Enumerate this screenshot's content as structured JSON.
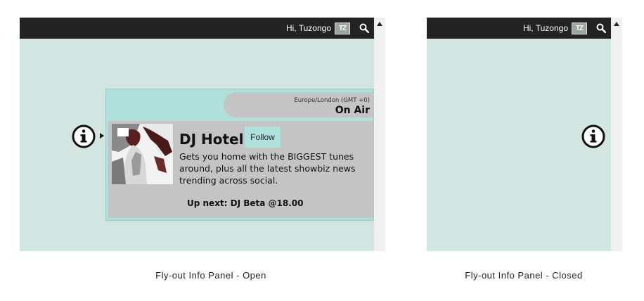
{
  "open_view": {
    "caption": "Fly-out Info Panel - Open",
    "topbar": {
      "greeting": "Hi, Tuzongo",
      "avatar_initials": "TZ",
      "search_icon": "search-icon"
    },
    "panel": {
      "timezone": "Europe/London (GMT +0)",
      "status": "On Air",
      "dj_name": "DJ Hotel",
      "follow_label": "Follow",
      "description": "Gets you home with the BIGGEST tunes around, plus all the latest showbiz news trending across social.",
      "up_next": "Up next: DJ Beta @18.00"
    },
    "info_icon": "info-icon"
  },
  "closed_view": {
    "caption": "Fly-out Info Panel - Closed",
    "topbar": {
      "greeting": "Hi, Tuzongo",
      "avatar_initials": "TZ",
      "search_icon": "search-icon"
    },
    "info_icon": "info-icon"
  },
  "colors": {
    "topbar": "#232323",
    "background": "#d3e5e0",
    "panel_accent": "#b0e0dc",
    "panel_body": "#c4c4c4"
  }
}
